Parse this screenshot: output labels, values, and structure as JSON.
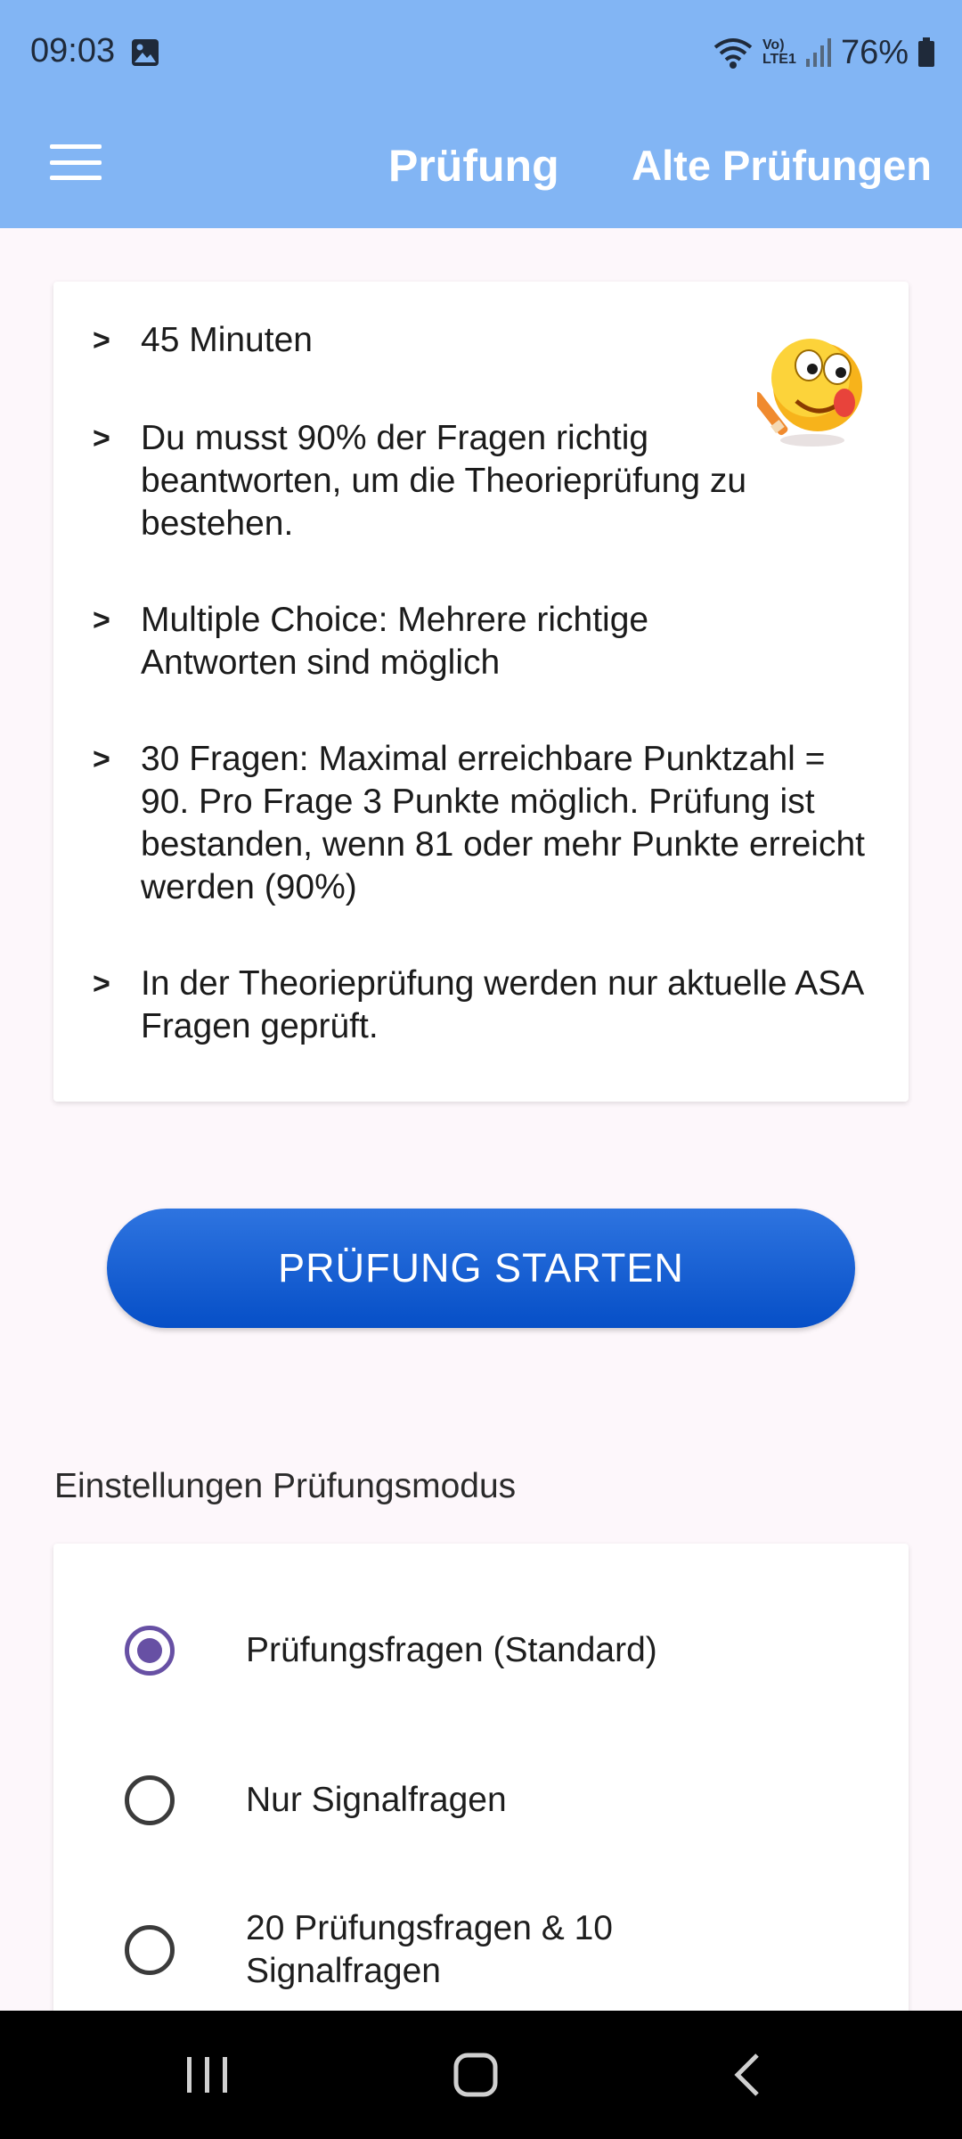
{
  "status_bar": {
    "time": "09:03",
    "network": "Vo) LTE1",
    "battery": "76%"
  },
  "app_bar": {
    "title": "Prüfung",
    "action": "Alte Prüfungen"
  },
  "info": [
    {
      "bullet": ">",
      "text": "45 Minuten"
    },
    {
      "bullet": ">",
      "text": "Du musst 90% der Fragen richtig beantworten, um die Theorieprüfung zu bestehen."
    },
    {
      "bullet": ">",
      "text": "Multiple Choice: Mehrere richtige Antworten sind möglich"
    },
    {
      "bullet": ">",
      "text": "30 Fragen: Maximal erreichbare Punktzahl = 90. Pro Frage 3 Punkte möglich. Prüfung ist bestanden, wenn 81 oder mehr Punkte erreicht werden (90%)"
    },
    {
      "bullet": ">",
      "text": "In der Theorieprüfung werden nur aktuelle ASA Fragen geprüft."
    }
  ],
  "start_button": "PRÜFUNG STARTEN",
  "settings": {
    "heading": "Einstellungen Prüfungsmodus",
    "options": [
      {
        "label": "Prüfungsfragen (Standard)",
        "selected": true
      },
      {
        "label": "Nur Signalfragen",
        "selected": false
      },
      {
        "label": "20 Prüfungsfragen & 10 Signalfragen",
        "selected": false
      }
    ]
  },
  "colors": {
    "app_bar": "#82b5f4",
    "button": "#0a55cc",
    "radio_selected": "#6750a4"
  },
  "icons": [
    "menu-icon",
    "image-icon",
    "wifi-icon",
    "signal-icon",
    "battery-icon",
    "emoji-icon",
    "recents-icon",
    "home-icon",
    "back-icon"
  ]
}
